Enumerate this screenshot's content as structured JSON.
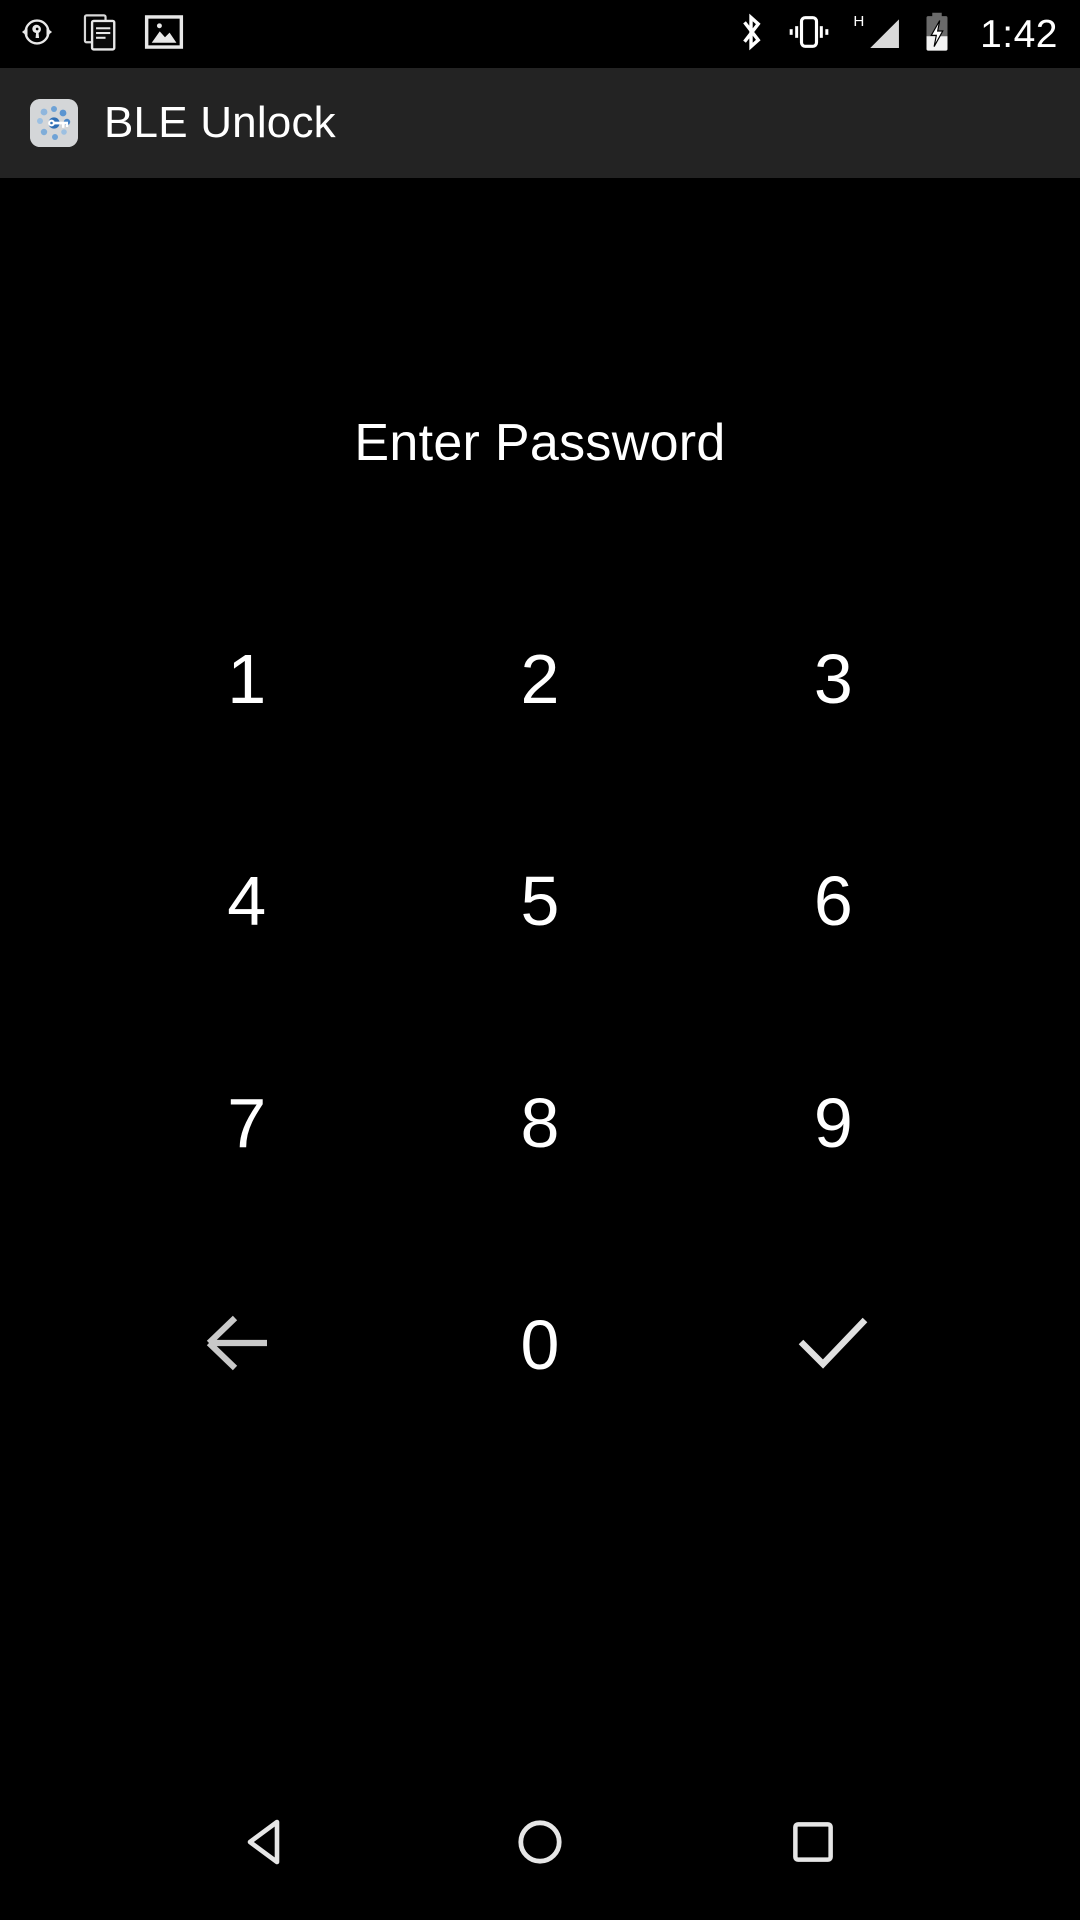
{
  "status_bar": {
    "left_icons": [
      {
        "name": "sync-wrench-icon",
        "label": "sync"
      },
      {
        "name": "copy-documents-icon",
        "label": "copy"
      },
      {
        "name": "image-gallery-icon",
        "label": "image"
      }
    ],
    "right_icons": [
      {
        "name": "bluetooth-icon",
        "label": "bluetooth"
      },
      {
        "name": "vibrate-icon",
        "label": "vibrate"
      },
      {
        "name": "signal-hspa-icon",
        "label": "H"
      },
      {
        "name": "battery-charging-icon",
        "label": "battery charging"
      }
    ],
    "signal_type": "H",
    "clock": "1:42"
  },
  "app_bar": {
    "icon_name": "ble-unlock-app-icon",
    "title": "BLE Unlock",
    "background": "#232323"
  },
  "main": {
    "prompt": "Enter Password",
    "keypad": [
      {
        "name": "key-1",
        "type": "digit",
        "label": "1"
      },
      {
        "name": "key-2",
        "type": "digit",
        "label": "2"
      },
      {
        "name": "key-3",
        "type": "digit",
        "label": "3"
      },
      {
        "name": "key-4",
        "type": "digit",
        "label": "4"
      },
      {
        "name": "key-5",
        "type": "digit",
        "label": "5"
      },
      {
        "name": "key-6",
        "type": "digit",
        "label": "6"
      },
      {
        "name": "key-7",
        "type": "digit",
        "label": "7"
      },
      {
        "name": "key-8",
        "type": "digit",
        "label": "8"
      },
      {
        "name": "key-9",
        "type": "digit",
        "label": "9"
      },
      {
        "name": "key-backspace",
        "type": "icon",
        "icon": "back-arrow-icon",
        "label": ""
      },
      {
        "name": "key-0",
        "type": "digit",
        "label": "0"
      },
      {
        "name": "key-confirm",
        "type": "icon",
        "icon": "checkmark-icon",
        "label": ""
      }
    ]
  },
  "nav_bar": {
    "back_label": "back-triangle-icon",
    "home_label": "home-circle-icon",
    "recents_label": "recents-square-icon"
  },
  "colors": {
    "background": "#000000",
    "app_bar": "#232323",
    "text": "#ffffff",
    "icon_gray": "#c9c9c9",
    "app_icon_bg": "#d4d6d8",
    "app_icon_accent": "#4a86c8"
  }
}
